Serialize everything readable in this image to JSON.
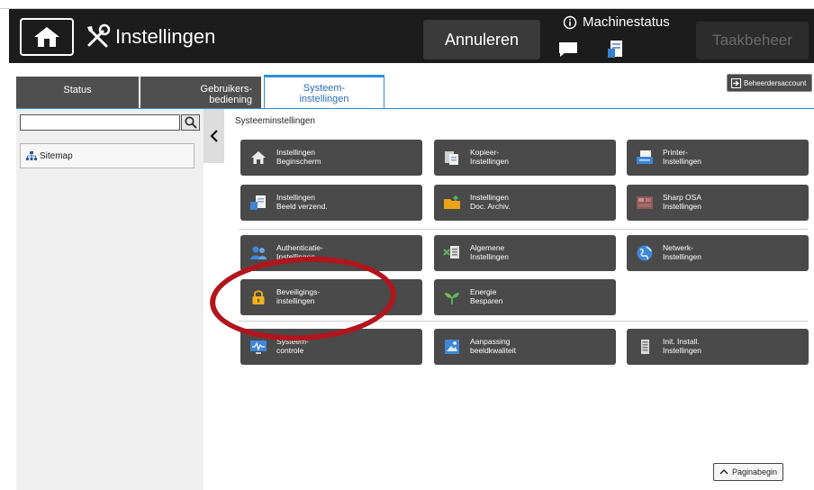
{
  "header": {
    "home_icon": "home-icon",
    "title_icon": "tools-icon",
    "title": "Instellingen",
    "cancel_label": "Annuleren",
    "machine_status_label": "Machinestatus",
    "job_label": "Taakbeheer"
  },
  "tabs": [
    {
      "label": "Status"
    },
    {
      "label": "Gebruikers-\nbediening"
    },
    {
      "label": "Systeem-\ninstellingen"
    }
  ],
  "admin_button_label": "Beheerdersaccount",
  "sidebar": {
    "search_value": "",
    "search_icon": "search-icon",
    "sitemap_label": "Sitemap"
  },
  "main": {
    "section_title": "Systeeminstellingen",
    "tiles": [
      {
        "label": "Instellingen\nBeginscherm",
        "icon": "home-icon"
      },
      {
        "label": "Kopieer-\nInstellingen",
        "icon": "copier-icon"
      },
      {
        "label": "Printer-\nInstellingen",
        "icon": "printer-icon"
      },
      {
        "label": "Instellingen\nBeeld verzend.",
        "icon": "image-send-icon"
      },
      {
        "label": "Instellingen\nDoc. Archiv.",
        "icon": "folder-icon"
      },
      {
        "label": "Sharp OSA\nInstellingen",
        "icon": "sharp-osa-icon"
      },
      {
        "label": "Authenticatie-\nInstellingen",
        "icon": "users-icon"
      },
      {
        "label": "Algemene\nInstellingen",
        "icon": "general-settings-icon"
      },
      {
        "label": "Netwerk-\nInstellingen",
        "icon": "globe-icon"
      },
      {
        "label": "Beveiligings-\ninstellingen",
        "icon": "lock-icon"
      },
      {
        "label": "Energie\nBesparen",
        "icon": "leaf-icon"
      },
      {
        "label": "Systeem-\ncontrole",
        "icon": "system-monitor-icon"
      },
      {
        "label": "Aanpassing\nbeeldkwaliteit",
        "icon": "image-quality-icon"
      },
      {
        "label": "Init. Install.\nInstellingen",
        "icon": "init-install-icon"
      }
    ],
    "page_top_label": "Paginabegin"
  },
  "colors": {
    "header_bg": "#1c1c1c",
    "tile_bg": "#4a4a4a",
    "active_tab_accent": "#2e8fd6",
    "highlight_ring": "#b3151d"
  }
}
